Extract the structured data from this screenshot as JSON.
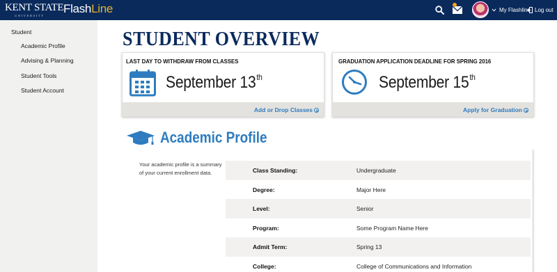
{
  "header": {
    "brand_main": "KENT STATE",
    "brand_sub": "UNIVERSITY",
    "app_name_a": "Flash",
    "app_name_b": "Line",
    "my_flashline_label": "My Flashline",
    "logout_label": "Log out",
    "icons": [
      "search-icon",
      "mail-icon",
      "chevron-down-icon",
      "logout-icon"
    ],
    "accent_color": "#e9b32a",
    "bar_color": "#0a2a5c"
  },
  "sidebar": {
    "heading": "Student",
    "items": [
      {
        "label": "Academic Profile"
      },
      {
        "label": "Advising & Planning"
      },
      {
        "label": "Student Tools"
      },
      {
        "label": "Student Account"
      }
    ]
  },
  "main": {
    "title": "STUDENT OVERVIEW",
    "cards": [
      {
        "heading": "LAST DAY TO WITHDRAW FROM CLASSES",
        "date_text": "September 13",
        "date_suffix": "th",
        "link_label": "Add or Drop Classes",
        "icon": "calendar-icon"
      },
      {
        "heading": "GRADUATION APPLICATION DEADLINE FOR SPRING 2016",
        "date_text": "September 15",
        "date_suffix": "th",
        "link_label": "Apply for Graduation",
        "icon": "clock-icon"
      }
    ],
    "profile": {
      "title": "Academic Profile",
      "icon": "graduation-cap-icon",
      "description": "Your academic profile is a summary of your current enrollment data.",
      "rows": [
        {
          "label": "Class Standing:",
          "value": "Undergraduate"
        },
        {
          "label": "Degree:",
          "value": "Major Here"
        },
        {
          "label": "Level:",
          "value": "Senior"
        },
        {
          "label": "Program:",
          "value": "Some Program Name Here"
        },
        {
          "label": "Admit Term:",
          "value": "Spring 13"
        },
        {
          "label": "College:",
          "value": "College of Communications and Information"
        }
      ]
    },
    "link_color": "#2e7cbf"
  }
}
